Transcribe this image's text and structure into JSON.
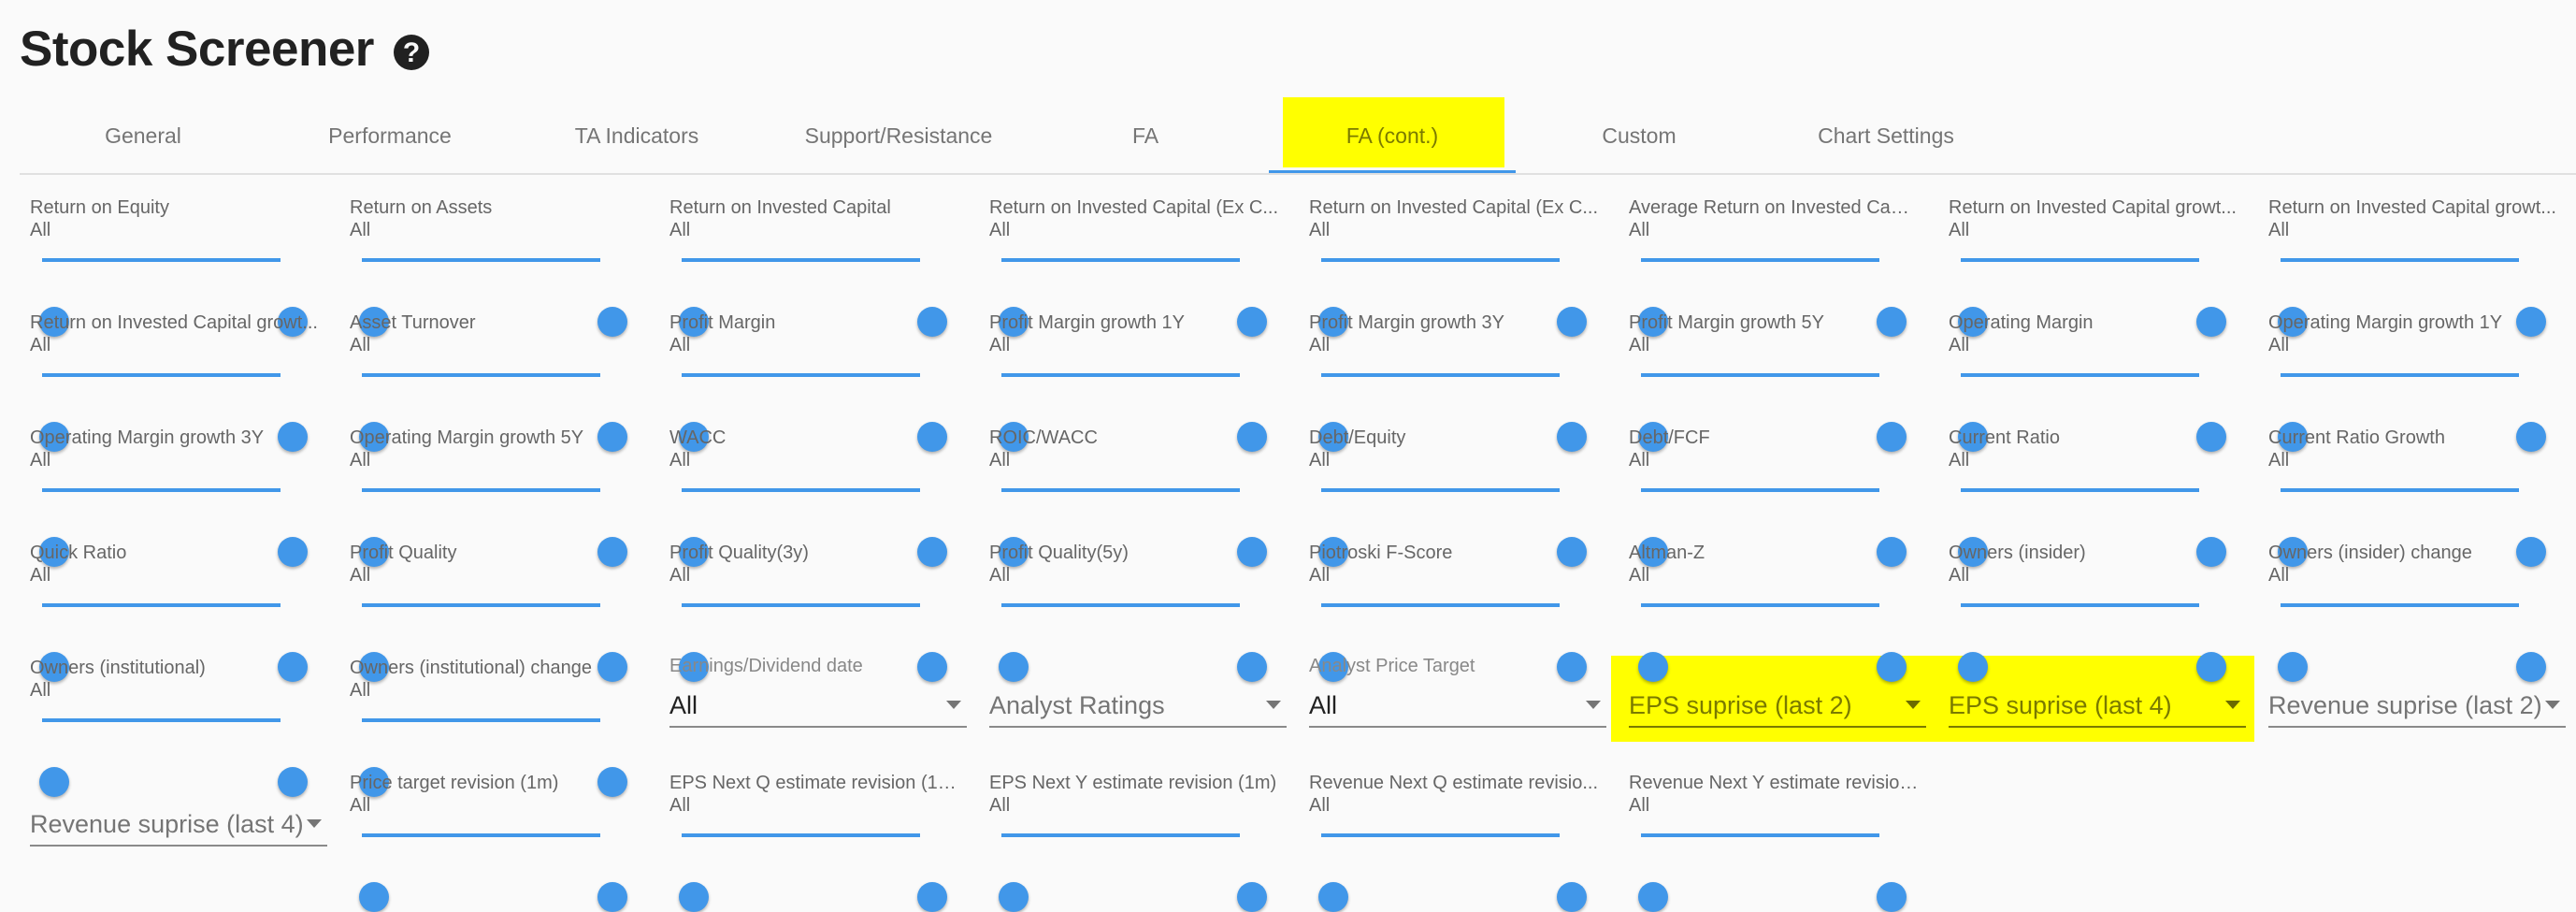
{
  "header": {
    "title": "Stock Screener",
    "help_icon": "question-circle-icon"
  },
  "tabs": [
    {
      "label": "General",
      "active": false
    },
    {
      "label": "Performance",
      "active": false
    },
    {
      "label": "TA Indicators",
      "active": false
    },
    {
      "label": "Support/Resistance",
      "active": false
    },
    {
      "label": "FA",
      "active": false
    },
    {
      "label": "FA (cont.)",
      "active": true,
      "highlighted": true
    },
    {
      "label": "Custom",
      "active": false
    },
    {
      "label": "Chart Settings",
      "active": false
    }
  ],
  "colors": {
    "accent": "#4197e9",
    "highlight": "#ffff00"
  },
  "sliders": [
    {
      "label": "Return on Equity",
      "value": "All"
    },
    {
      "label": "Return on Assets",
      "value": "All"
    },
    {
      "label": "Return on Invested Capital",
      "value": "All"
    },
    {
      "label": "Return on Invested Capital (Ex C...",
      "value": "All"
    },
    {
      "label": "Return on Invested Capital (Ex C...",
      "value": "All"
    },
    {
      "label": "Average Return on Invested Capit...",
      "value": "All"
    },
    {
      "label": "Return on Invested Capital growt...",
      "value": "All"
    },
    {
      "label": "Return on Invested Capital growt...",
      "value": "All"
    },
    {
      "label": "Return on Invested Capital growt...",
      "value": "All"
    },
    {
      "label": "Asset Turnover",
      "value": "All"
    },
    {
      "label": "Profit Margin",
      "value": "All"
    },
    {
      "label": "Profit Margin growth 1Y",
      "value": "All"
    },
    {
      "label": "Profit Margin growth 3Y",
      "value": "All"
    },
    {
      "label": "Profit Margin growth 5Y",
      "value": "All"
    },
    {
      "label": "Operating Margin",
      "value": "All"
    },
    {
      "label": "Operating Margin growth 1Y",
      "value": "All"
    },
    {
      "label": "Operating Margin growth 3Y",
      "value": "All"
    },
    {
      "label": "Operating Margin growth 5Y",
      "value": "All"
    },
    {
      "label": "WACC",
      "value": "All"
    },
    {
      "label": "ROIC/WACC",
      "value": "All"
    },
    {
      "label": "Debt/Equity",
      "value": "All"
    },
    {
      "label": "Debt/FCF",
      "value": "All"
    },
    {
      "label": "Current Ratio",
      "value": "All"
    },
    {
      "label": "Current Ratio Growth",
      "value": "All"
    },
    {
      "label": "Quick Ratio",
      "value": "All"
    },
    {
      "label": "Profit Quality",
      "value": "All"
    },
    {
      "label": "Profit Quality(3y)",
      "value": "All"
    },
    {
      "label": "Profit Quality(5y)",
      "value": "All"
    },
    {
      "label": "Piotroski F-Score",
      "value": "All"
    },
    {
      "label": "Altman-Z",
      "value": "All"
    },
    {
      "label": "Owners (insider)",
      "value": "All"
    },
    {
      "label": "Owners (insider) change",
      "value": "All"
    },
    {
      "label": "Owners (institutional)",
      "value": "All"
    },
    {
      "label": "Owners (institutional) change",
      "value": "All"
    }
  ],
  "dropdowns": [
    {
      "label": "Earnings/Dividend date",
      "value": "All",
      "placeholder": ""
    },
    {
      "label": "",
      "value": "",
      "placeholder": "Analyst Ratings"
    },
    {
      "label": "Analyst Price Target",
      "value": "All",
      "placeholder": ""
    },
    {
      "label": "",
      "value": "",
      "placeholder": "EPS suprise (last 2)",
      "highlighted": true
    },
    {
      "label": "",
      "value": "",
      "placeholder": "EPS suprise (last 4)",
      "highlighted": true
    },
    {
      "label": "",
      "value": "",
      "placeholder": "Revenue suprise (last 2)"
    },
    {
      "label": "",
      "value": "",
      "placeholder": "Revenue suprise (last 4)"
    }
  ],
  "sliders_row6": [
    {
      "label": "Price target revision (1m)",
      "value": "All"
    },
    {
      "label": "EPS Next Q estimate revision (1m)",
      "value": "All"
    },
    {
      "label": "EPS Next Y estimate revision (1m)",
      "value": "All"
    },
    {
      "label": "Revenue Next Q estimate revisio...",
      "value": "All"
    },
    {
      "label": "Revenue Next Y estimate revision...",
      "value": "All"
    }
  ]
}
